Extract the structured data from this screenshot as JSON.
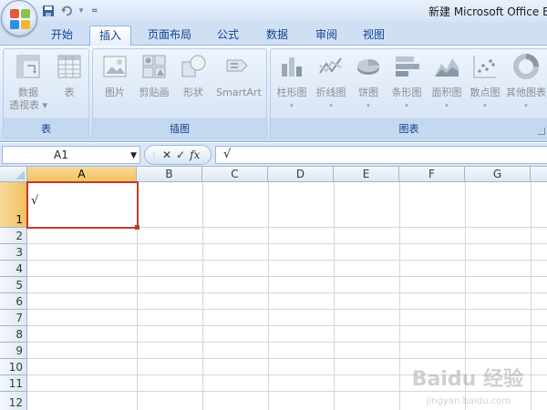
{
  "window": {
    "title": "新建 Microsoft Office E"
  },
  "quick_access": {
    "items": [
      "save-icon",
      "undo-icon",
      "redo-icon"
    ],
    "dropdown_glyph": "▾",
    "customize_glyph": "="
  },
  "tabs": [
    {
      "label": "开始",
      "active": false
    },
    {
      "label": "插入",
      "active": true
    },
    {
      "label": "页面布局",
      "active": false
    },
    {
      "label": "公式",
      "active": false
    },
    {
      "label": "数据",
      "active": false
    },
    {
      "label": "审阅",
      "active": false
    },
    {
      "label": "视图",
      "active": false
    }
  ],
  "ribbon": {
    "groups": [
      {
        "label": "表",
        "buttons": [
          {
            "line1": "数据",
            "line2": "透视表 ▾",
            "icon": "pivot-table-icon"
          },
          {
            "line1": "表",
            "line2": "",
            "icon": "table-icon"
          }
        ]
      },
      {
        "label": "插图",
        "buttons": [
          {
            "line1": "图片",
            "icon": "picture-icon"
          },
          {
            "line1": "剪贴画",
            "icon": "clipart-icon"
          },
          {
            "line1": "形状",
            "icon": "shapes-icon"
          },
          {
            "line1": "SmartArt",
            "icon": "smartart-icon"
          }
        ]
      },
      {
        "label": "图表",
        "buttons": [
          {
            "line1": "柱形图",
            "icon": "column-chart-icon"
          },
          {
            "line1": "折线图",
            "icon": "line-chart-icon"
          },
          {
            "line1": "饼图",
            "icon": "pie-chart-icon"
          },
          {
            "line1": "条形图",
            "icon": "bar-chart-icon"
          },
          {
            "line1": "面积图",
            "icon": "area-chart-icon"
          },
          {
            "line1": "散点图",
            "icon": "scatter-chart-icon"
          },
          {
            "line1": "其他图表",
            "icon": "other-charts-icon"
          }
        ]
      }
    ]
  },
  "formula_bar": {
    "name_box": "A1",
    "cancel_glyph": "✕",
    "enter_glyph": "✓",
    "fx_label": "fx",
    "content": "√"
  },
  "sheet": {
    "columns": [
      "A",
      "B",
      "C",
      "D",
      "E",
      "F",
      "G"
    ],
    "rows": [
      "1",
      "2",
      "3",
      "4",
      "5",
      "6",
      "7",
      "8",
      "9",
      "10",
      "11",
      "12"
    ],
    "selected_cell": "A1",
    "cells": {
      "A1": "√"
    }
  },
  "watermark": {
    "main": "Baidu 经验",
    "sub": "jingyan.baidu.com"
  },
  "colors": {
    "accent": "#15428b",
    "selection_border": "#c0392b",
    "header_selected": "#f1c15f"
  }
}
